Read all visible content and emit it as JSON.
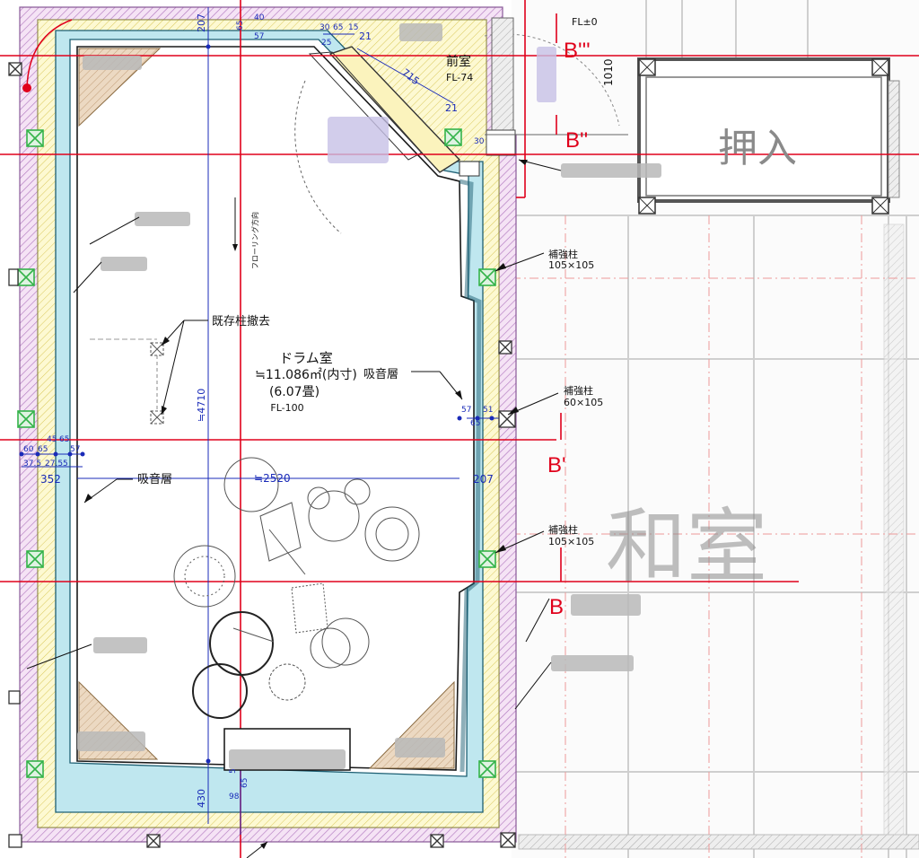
{
  "rooms": {
    "drum_room": {
      "name": "ドラム室",
      "area": "≒11.086㎡(内寸)",
      "mats": "(6.07畳)",
      "floor_level": "FL-100"
    },
    "anteroom": {
      "name": "前室",
      "floor_level": "FL-74"
    },
    "closet": {
      "name": "押入"
    },
    "washitsu": {
      "name": "和室"
    },
    "fl_zero": "FL±0"
  },
  "labels": {
    "existing_column_removal": "既存柱撤去",
    "absorption_layer_right": "吸音層",
    "absorption_layer_left": "吸音層",
    "flooring_direction": "フローリング方向",
    "reinforcing_column_1": {
      "name": "補強柱",
      "size": "105×105"
    },
    "reinforcing_column_2": {
      "name": "補強柱",
      "size": "60×105"
    },
    "reinforcing_column_3": {
      "name": "補強柱",
      "size": "105×105"
    }
  },
  "section_marks": {
    "b3": "B'''",
    "b2": "B''",
    "b1": "B'",
    "b0": "B"
  },
  "dimensions": {
    "top_207": "207",
    "top_65": "65",
    "top_40": "40",
    "top_57": "57",
    "door_30": "30",
    "door_65": "65",
    "door_15": "15",
    "door_25": "25",
    "door_21a": "21",
    "door_715": "715",
    "door_21b": "21",
    "door_30b": "30",
    "vert_1010": "1010",
    "height_4710": "≒4710",
    "width_2520": "≒2520",
    "left_60": "60",
    "left_65": "65",
    "left_45": "45",
    "left_65b": "65",
    "left_57": "57",
    "left_375": "37.5",
    "left_275": "27.5",
    "left_5": "5",
    "left_352": "352",
    "right_57": "57",
    "right_51": "51",
    "right_65": "65",
    "right_207": "207",
    "bottom_430": "430",
    "bottom_98": "98",
    "bottom_65": "65",
    "bottom_5": "5"
  },
  "colors": {
    "wall_hatch": "#c9a3d4",
    "insulation": "#b9e4ee",
    "sound_layer": "#fdf6c4",
    "gridline": "#e0001b",
    "dimension": "#1a2bb8",
    "corner_fill": "#ead6bd",
    "column_green": "#34b34a"
  }
}
